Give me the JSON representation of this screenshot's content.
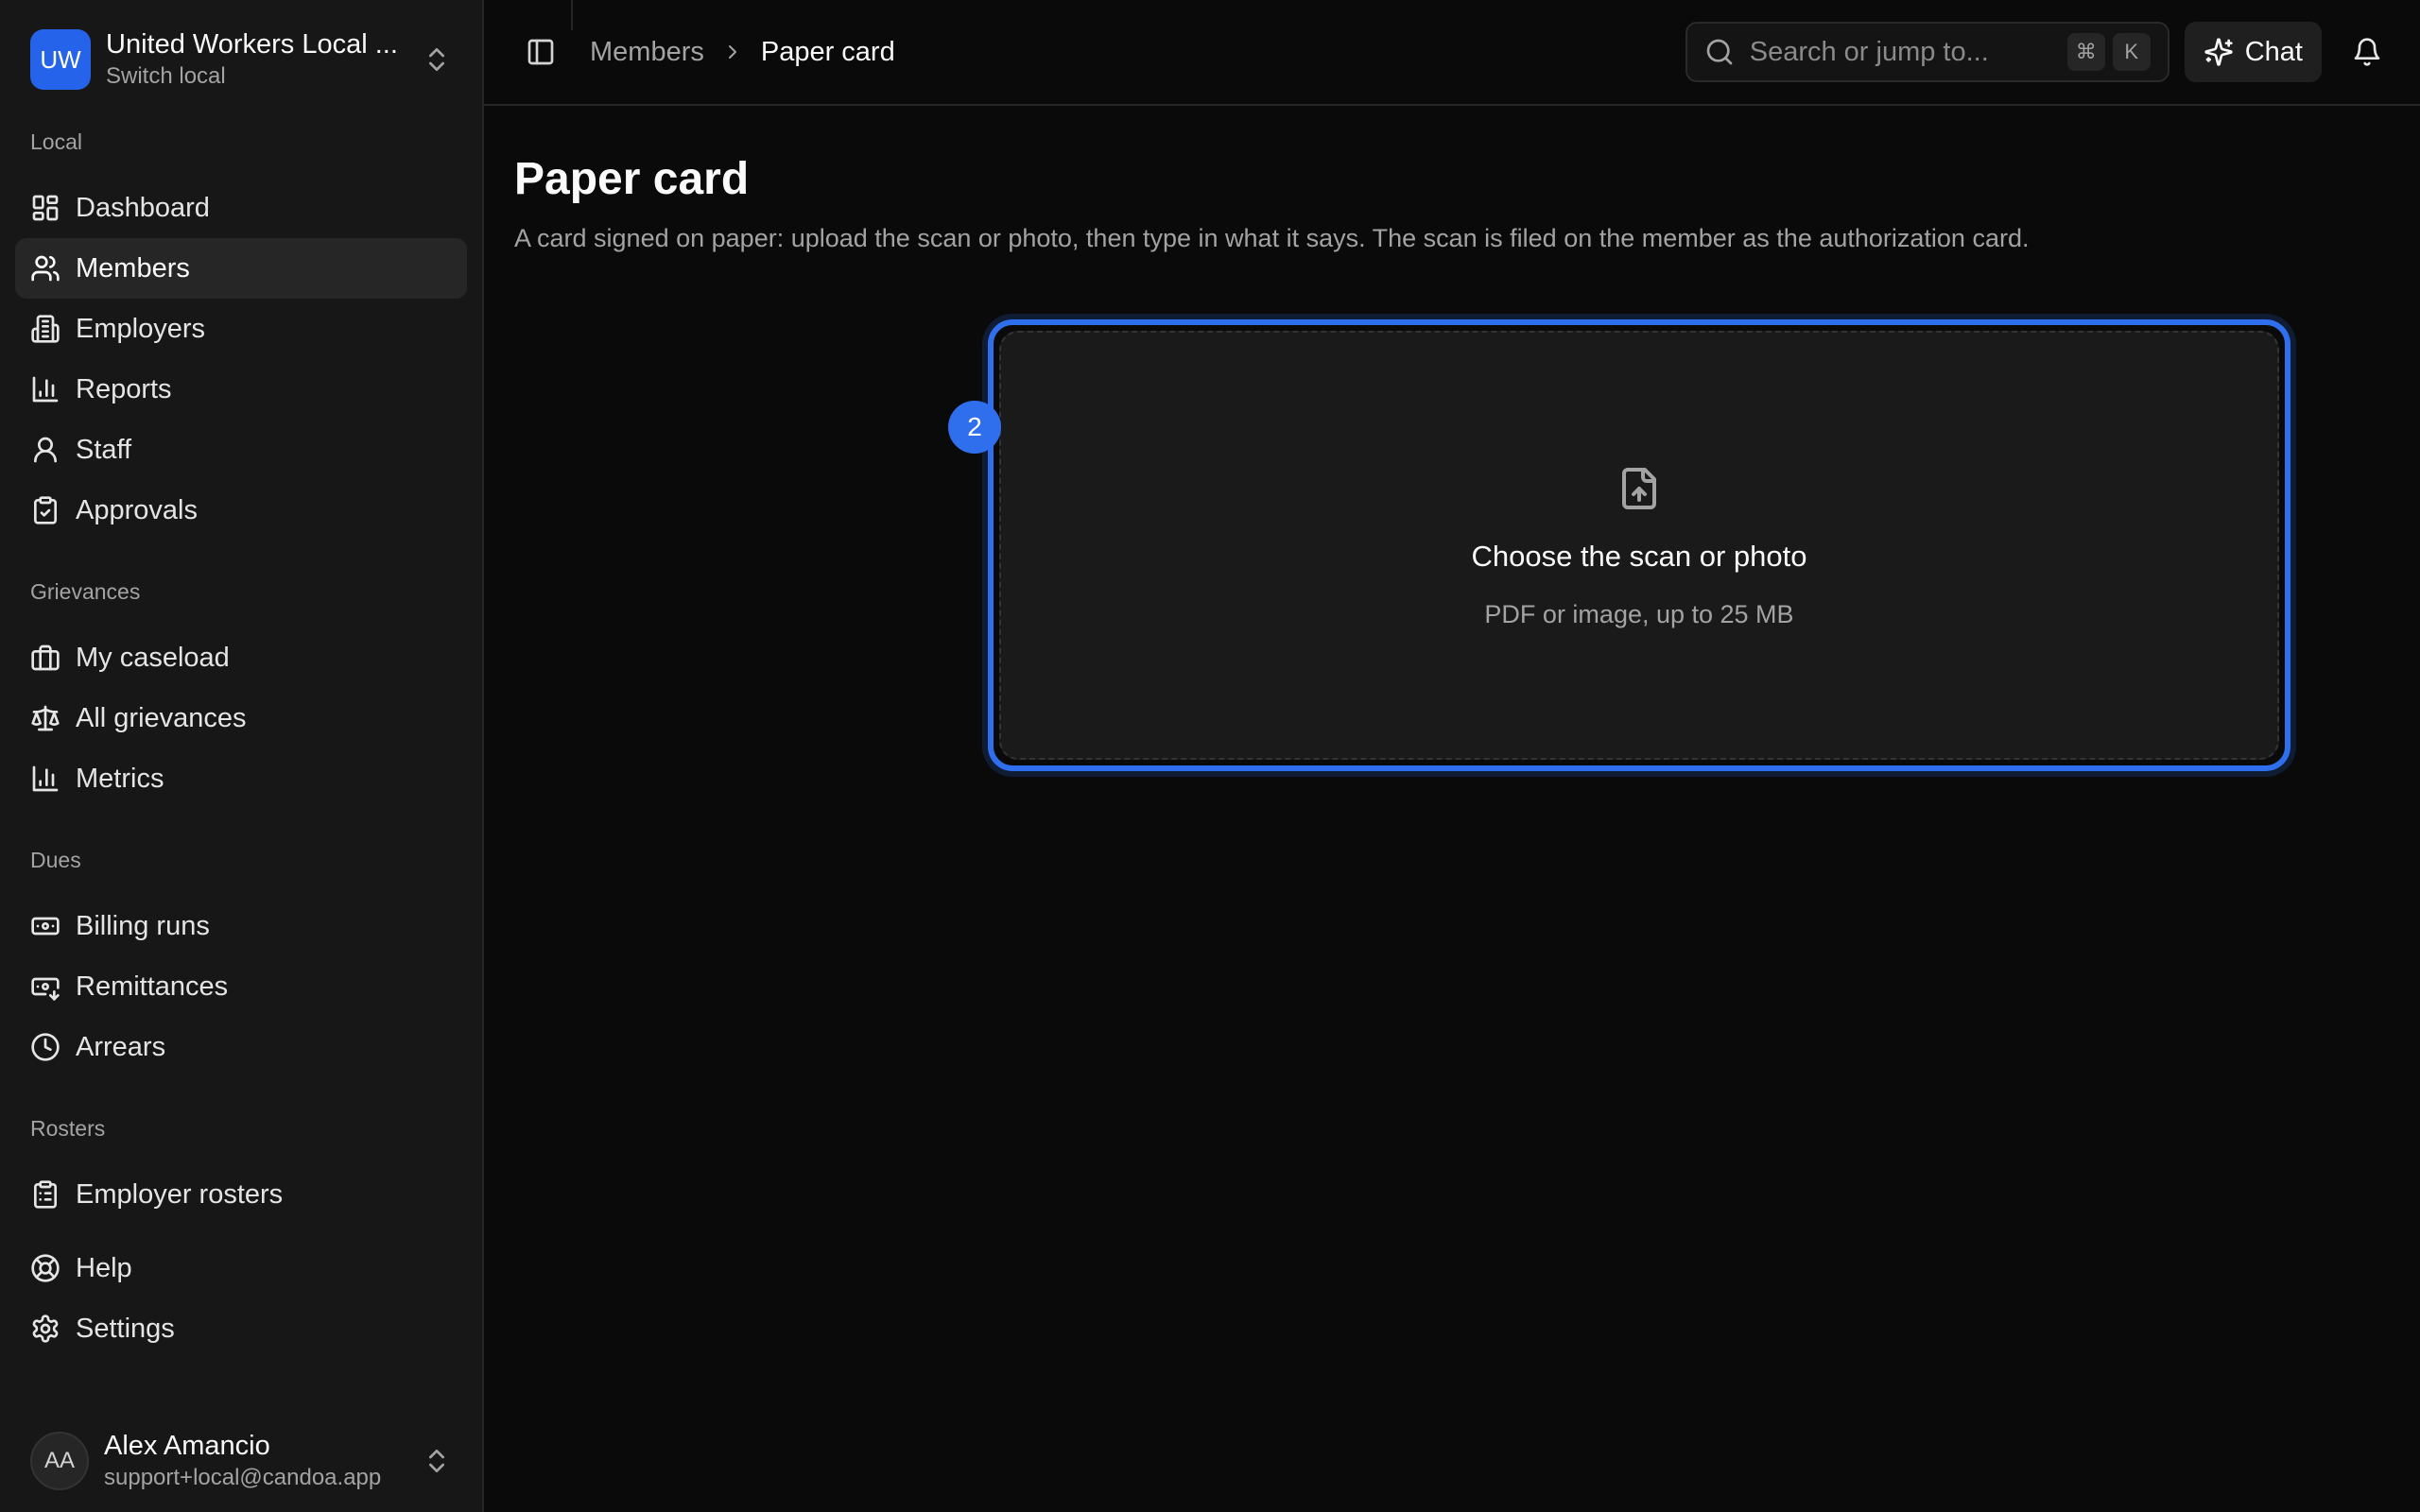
{
  "org": {
    "initials": "UW",
    "name": "United Workers Local ...",
    "switch_label": "Switch local"
  },
  "sidebar": {
    "sections": [
      {
        "label": "Local",
        "items": [
          {
            "label": "Dashboard",
            "icon": "dashboard-icon"
          },
          {
            "label": "Members",
            "icon": "users-icon",
            "active": true
          },
          {
            "label": "Employers",
            "icon": "building-icon"
          },
          {
            "label": "Reports",
            "icon": "bar-chart-icon"
          },
          {
            "label": "Staff",
            "icon": "user-icon"
          },
          {
            "label": "Approvals",
            "icon": "clipboard-check-icon"
          }
        ]
      },
      {
        "label": "Grievances",
        "items": [
          {
            "label": "My caseload",
            "icon": "briefcase-icon"
          },
          {
            "label": "All grievances",
            "icon": "scale-icon"
          },
          {
            "label": "Metrics",
            "icon": "bar-chart-icon"
          }
        ]
      },
      {
        "label": "Dues",
        "items": [
          {
            "label": "Billing runs",
            "icon": "banknote-icon"
          },
          {
            "label": "Remittances",
            "icon": "banknote-arrow-icon"
          },
          {
            "label": "Arrears",
            "icon": "clock-icon"
          }
        ]
      },
      {
        "label": "Rosters",
        "items": [
          {
            "label": "Employer rosters",
            "icon": "clipboard-list-icon"
          }
        ]
      }
    ],
    "footer_items": [
      {
        "label": "Help",
        "icon": "life-buoy-icon"
      },
      {
        "label": "Settings",
        "icon": "gear-icon"
      }
    ]
  },
  "user": {
    "initials": "AA",
    "name": "Alex Amancio",
    "email": "support+local@candoa.app"
  },
  "topbar": {
    "breadcrumb": {
      "parent": "Members",
      "current": "Paper card"
    },
    "search_placeholder": "Search or jump to...",
    "kbd_cmd": "⌘",
    "kbd_key": "K",
    "chat_label": "Chat"
  },
  "page": {
    "title": "Paper card",
    "description": "A card signed on paper: upload the scan or photo, then type in what it says. The scan is filed on the member as the authorization card."
  },
  "upload": {
    "step": "2",
    "title": "Choose the scan or photo",
    "hint": "PDF or image, up to 25 MB",
    "accent": "#2f6fed"
  }
}
